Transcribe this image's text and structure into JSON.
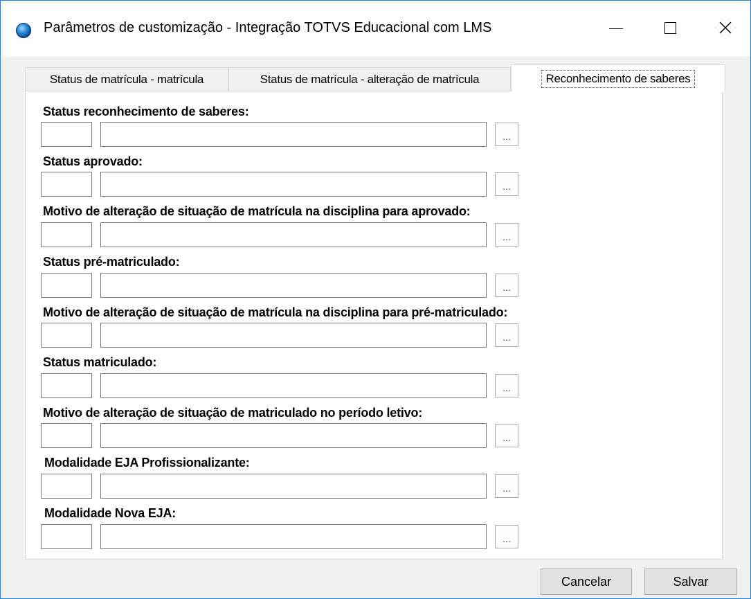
{
  "window": {
    "title": "Parâmetros de customização - Integração TOTVS Educacional com LMS",
    "controls": {
      "minimize": "—",
      "maximize": "☐",
      "close": "✕"
    }
  },
  "tabs": [
    {
      "label": "Status de matrícula - matrícula",
      "selected": false
    },
    {
      "label": "Status de matrícula - alteração de matrícula",
      "selected": false
    },
    {
      "label": "Reconhecimento de saberes",
      "selected": true
    }
  ],
  "fields": [
    {
      "label": "Status reconhecimento de saberes:",
      "code": "",
      "description": "",
      "lookup": "..."
    },
    {
      "label": "Status aprovado:",
      "code": "",
      "description": "",
      "lookup": "..."
    },
    {
      "label": "Motivo de alteração de situação de matrícula na disciplina para aprovado:",
      "code": "",
      "description": "",
      "lookup": "..."
    },
    {
      "label": "Status pré-matriculado:",
      "code": "",
      "description": "",
      "lookup": "..."
    },
    {
      "label": "Motivo de alteração de situação de matrícula na disciplina para pré-matriculado:",
      "code": "",
      "description": "",
      "lookup": "..."
    },
    {
      "label": "Status matriculado:",
      "code": "",
      "description": "",
      "lookup": "..."
    },
    {
      "label": "Motivo de alteração de situação de matriculado no período letivo:",
      "code": "",
      "description": "",
      "lookup": "..."
    },
    {
      "label": "Modalidade EJA Profissionalizante:",
      "code": "",
      "description": "",
      "lookup": "..."
    },
    {
      "label": "Modalidade Nova EJA:",
      "code": "",
      "description": "",
      "lookup": "..."
    }
  ],
  "footer": {
    "cancel_label": "Cancelar",
    "save_label": "Salvar"
  },
  "colors": {
    "window_border": "#1883d7",
    "background": "#f0f0f0",
    "panel": "#ffffff"
  },
  "icons": {
    "app": "totvs-app-icon",
    "minimize": "minimize-icon",
    "maximize": "maximize-icon",
    "close": "close-icon"
  }
}
